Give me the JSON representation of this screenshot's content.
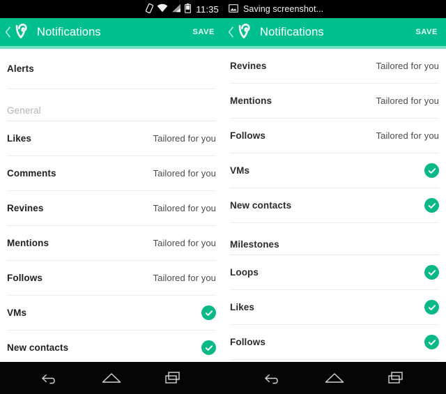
{
  "theme": {
    "brand_green": "#00bf8f",
    "check_green": "#0ab787",
    "statusbar_bg": "#000000",
    "navbar_bg": "#050505",
    "row_text": "#212121",
    "value_text": "#4a4a4a",
    "section_text": "#b3b3b3"
  },
  "left": {
    "statusbar": {
      "notification_text": "",
      "clock": "11:35",
      "icons": [
        "vibrate-icon",
        "wifi-icon",
        "signal-icon",
        "battery-icon"
      ]
    },
    "appbar": {
      "back_icon": "chevron-left-icon",
      "logo_icon": "vine-logo-icon",
      "title": "Notifications",
      "save_label": "SAVE"
    },
    "rows": [
      {
        "label": "Alerts",
        "type": "plain",
        "value": ""
      },
      {
        "label": "General",
        "type": "section",
        "value": ""
      },
      {
        "label": "Likes",
        "type": "value",
        "value": "Tailored for you"
      },
      {
        "label": "Comments",
        "type": "value",
        "value": "Tailored for you"
      },
      {
        "label": "Revines",
        "type": "value",
        "value": "Tailored for you"
      },
      {
        "label": "Mentions",
        "type": "value",
        "value": "Tailored for you"
      },
      {
        "label": "Follows",
        "type": "value",
        "value": "Tailored for you"
      },
      {
        "label": "VMs",
        "type": "check",
        "value": ""
      },
      {
        "label": "New contacts",
        "type": "check",
        "value": ""
      }
    ],
    "navbar": [
      "back-icon",
      "home-icon",
      "recents-icon"
    ]
  },
  "right": {
    "statusbar": {
      "notification_icon": "image-icon",
      "notification_text": "Saving screenshot...",
      "clock": "",
      "icons": []
    },
    "appbar": {
      "back_icon": "chevron-left-icon",
      "logo_icon": "vine-logo-icon",
      "title": "Notifications",
      "save_label": "SAVE"
    },
    "rows": [
      {
        "label": "Revines",
        "type": "value",
        "value": "Tailored for you"
      },
      {
        "label": "Mentions",
        "type": "value",
        "value": "Tailored for you"
      },
      {
        "label": "Follows",
        "type": "value",
        "value": "Tailored for you"
      },
      {
        "label": "VMs",
        "type": "check",
        "value": ""
      },
      {
        "label": "New contacts",
        "type": "check",
        "value": ""
      },
      {
        "label": "Milestones",
        "type": "section",
        "value": ""
      },
      {
        "label": "Loops",
        "type": "check",
        "value": ""
      },
      {
        "label": "Likes",
        "type": "check",
        "value": ""
      },
      {
        "label": "Follows",
        "type": "check",
        "value": ""
      }
    ],
    "navbar": [
      "back-icon",
      "home-icon",
      "recents-icon"
    ]
  }
}
